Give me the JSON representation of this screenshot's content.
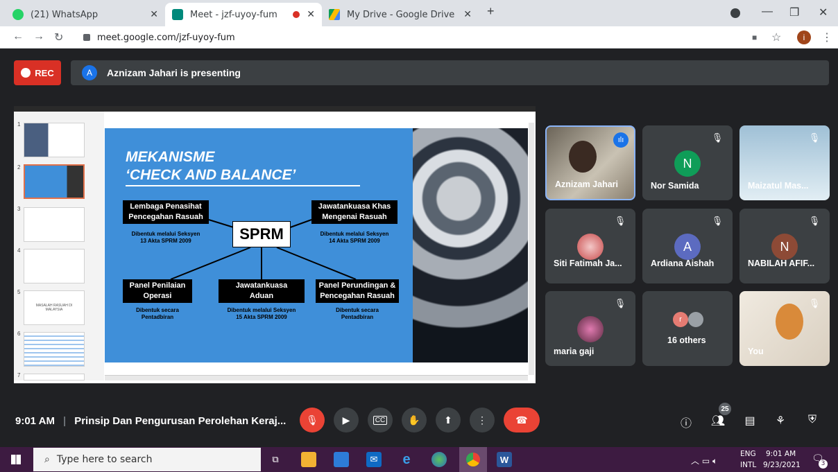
{
  "browser": {
    "tabs": [
      {
        "title": "(21) WhatsApp",
        "fav": "#25d366"
      },
      {
        "title": "Meet - jzf-uyoy-fum",
        "fav": "#00897b"
      },
      {
        "title": "My Drive - Google Drive",
        "fav": "#fbbc04"
      }
    ],
    "new_tab": "+",
    "url": "meet.google.com/jzf-uyoy-fum",
    "profile_initial": "i"
  },
  "meet": {
    "rec_label": "REC",
    "presenter_initial": "A",
    "presenter_text": "Aznizam Jahari is presenting",
    "slide": {
      "title1": "MEKANISME",
      "title2": "‘CHECK AND BALANCE’",
      "center": "SPRM",
      "boxes": [
        {
          "label1": "Lembaga Penasihat",
          "label2": "Pencegahan Rasuah",
          "sub1": "Dibentuk melalui Seksyen",
          "sub2": "13 Akta SPRM 2009"
        },
        {
          "label1": "Jawatankuasa Khas",
          "label2": "Mengenai Rasuah",
          "sub1": "Dibentuk melalui Seksyen",
          "sub2": "14 Akta SPRM 2009"
        },
        {
          "label1": "Panel Penilaian",
          "label2": "Operasi",
          "sub1": "Dibentuk secara",
          "sub2": "Pentadbiran"
        },
        {
          "label1": "Jawatankuasa",
          "label2": "Aduan",
          "sub1": "Dibentuk melalui Seksyen",
          "sub2": "15 Akta SPRM 2009"
        },
        {
          "label1": "Panel Perundingan &",
          "label2": "Pencegahan Rasuah",
          "sub1": "Dibentuk secara",
          "sub2": "Pentadbiran"
        }
      ],
      "thumb_numbers": [
        "1",
        "2",
        "3",
        "4",
        "5",
        "6",
        "7"
      ],
      "thumb5_text": "MASALAH RASUAH DI MALAYSIA"
    },
    "participants": [
      {
        "name": "Aznizam Jahari"
      },
      {
        "name": "Nor Samida",
        "initial": "N",
        "color": "#0f9d58"
      },
      {
        "name": "Maizatul Mas..."
      },
      {
        "name": "Siti Fatimah Ja..."
      },
      {
        "name": "Ardiana Aishah",
        "initial": "A",
        "color": "#5c6bc0"
      },
      {
        "name": "NABILAH AFIF...",
        "initial": "N",
        "color": "#8d4a36"
      },
      {
        "name": "maria gaji"
      },
      {
        "name": "16 others",
        "initial": "r"
      },
      {
        "name": "You"
      }
    ],
    "time": "9:01 AM",
    "separator": "|",
    "meeting_title": "Prinsip Dan Pengurusan Perolehan Keraj...",
    "participant_count": "25"
  },
  "taskbar": {
    "search_placeholder": "Type here to search",
    "lang1": "ENG",
    "lang2": "INTL",
    "clock_time": "9:01 AM",
    "clock_date": "9/23/2021",
    "notif_count": "3"
  }
}
